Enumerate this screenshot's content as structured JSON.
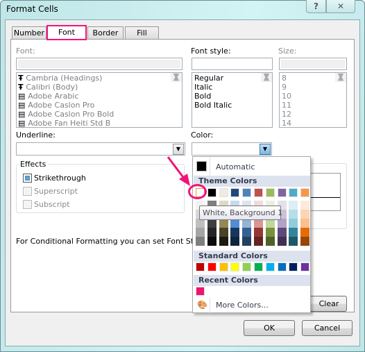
{
  "window": {
    "title": "Format Cells",
    "help_label": "?",
    "close_label": "✕"
  },
  "tabs": [
    {
      "label": "Number"
    },
    {
      "label": "Font",
      "active": true
    },
    {
      "label": "Border"
    },
    {
      "label": "Fill"
    }
  ],
  "font": {
    "label": "Font:",
    "value": "",
    "items": [
      "Cambria (Headings)",
      "Calibri (Body)",
      "Adobe Arabic",
      "Adobe Caslon Pro",
      "Adobe Caslon Pro Bold",
      "Adobe Fan Heiti Std B"
    ],
    "item_icons": [
      "truetype-icon",
      "truetype-icon",
      "opentype-icon",
      "opentype-icon",
      "opentype-icon",
      "opentype-icon"
    ]
  },
  "font_style": {
    "label": "Font style:",
    "value": "",
    "items": [
      "Regular",
      "Italic",
      "Bold",
      "Bold Italic"
    ]
  },
  "size": {
    "label": "Size:",
    "value": "",
    "items": [
      "8",
      "9",
      "10",
      "11",
      "12",
      "14"
    ]
  },
  "underline": {
    "label": "Underline:",
    "value": ""
  },
  "color": {
    "label": "Color:",
    "value": ""
  },
  "effects": {
    "label": "Effects",
    "strikethrough": {
      "label": "Strikethrough",
      "checked": true
    },
    "superscript": {
      "label": "Superscript",
      "checked": false
    },
    "subscript": {
      "label": "Subscript",
      "checked": false
    }
  },
  "info_text": "For Conditional Formatting you can set Font Style, Ur",
  "color_popup": {
    "automatic_label": "Automatic",
    "automatic_color": "#000000",
    "theme_label": "Theme Colors",
    "theme_colors": [
      "#FFFFFF",
      "#000000",
      "#EEECE1",
      "#1F497D",
      "#4F81BD",
      "#C0504D",
      "#9BBB59",
      "#8064A2",
      "#4BACC6",
      "#F79646"
    ],
    "theme_shades": [
      [
        "#F2F2F2",
        "#7F7F7F",
        "#DDD9C3",
        "#C6D9F0",
        "#DBE5F1",
        "#F2DCDB",
        "#EBF1DD",
        "#E5E0EC",
        "#DBEEF3",
        "#FDEADA"
      ],
      [
        "#D8D8D8",
        "#595959",
        "#C4BD97",
        "#8DB3E2",
        "#B8CCE4",
        "#E5B9B7",
        "#D7E3BC",
        "#CCC1D9",
        "#B7DDE8",
        "#FBD5B5"
      ],
      [
        "#BFBFBF",
        "#3F3F3F",
        "#938953",
        "#548DD4",
        "#95B3D7",
        "#D99694",
        "#C3D69B",
        "#B2A2C7",
        "#92CDDC",
        "#FAC08F"
      ],
      [
        "#A5A5A5",
        "#262626",
        "#494429",
        "#17365D",
        "#366092",
        "#953734",
        "#76923C",
        "#5F497A",
        "#31859B",
        "#E36C09"
      ],
      [
        "#7F7F7F",
        "#0C0C0C",
        "#1D1B10",
        "#0F243E",
        "#244061",
        "#632423",
        "#4F6128",
        "#3F3151",
        "#205867",
        "#974806"
      ]
    ],
    "standard_label": "Standard Colors",
    "standard_colors": [
      "#C00000",
      "#FF0000",
      "#FFC000",
      "#FFFF00",
      "#92D050",
      "#00B050",
      "#00B0F0",
      "#0070C0",
      "#002060",
      "#7030A0"
    ],
    "recent_label": "Recent Colors",
    "recent_colors": [
      "#F0146E"
    ],
    "more_colors_label": "More Colors...",
    "tooltip": "White, Background 1"
  },
  "clear_label": "Clear",
  "ok_label": "OK",
  "cancel_label": "Cancel",
  "annotation_color": "#F0147A"
}
